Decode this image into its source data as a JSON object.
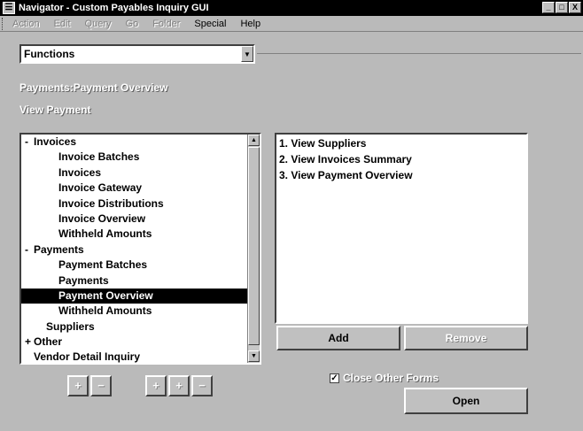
{
  "window": {
    "title": "Navigator - Custom Payables Inquiry GUI",
    "controls": [
      "_",
      "□",
      "X"
    ]
  },
  "menu": [
    {
      "label": "Action",
      "enabled": false
    },
    {
      "label": "Edit",
      "enabled": false
    },
    {
      "label": "Query",
      "enabled": false
    },
    {
      "label": "Go",
      "enabled": false
    },
    {
      "label": "Folder",
      "enabled": false
    },
    {
      "label": "Special",
      "enabled": true
    },
    {
      "label": "Help",
      "enabled": true
    }
  ],
  "functions_dropdown": {
    "value": "Functions"
  },
  "header": {
    "path": "Payments:Payment Overview",
    "subtitle": "View Payment"
  },
  "tree": {
    "items": [
      {
        "marker": "-",
        "indent": 0,
        "label": "Invoices"
      },
      {
        "marker": "",
        "indent": 1,
        "label": "Invoice Batches"
      },
      {
        "marker": "",
        "indent": 1,
        "label": "Invoices"
      },
      {
        "marker": "",
        "indent": 1,
        "label": "Invoice Gateway"
      },
      {
        "marker": "",
        "indent": 1,
        "label": "Invoice Distributions"
      },
      {
        "marker": "",
        "indent": 1,
        "label": "Invoice Overview"
      },
      {
        "marker": "",
        "indent": 1,
        "label": "Withheld Amounts"
      },
      {
        "marker": "-",
        "indent": 0,
        "label": "Payments"
      },
      {
        "marker": "",
        "indent": 1,
        "label": "Payment Batches"
      },
      {
        "marker": "",
        "indent": 1,
        "label": "Payments"
      },
      {
        "marker": "",
        "indent": 1,
        "label": "Payment Overview",
        "selected": true
      },
      {
        "marker": "",
        "indent": 1,
        "label": "Withheld Amounts"
      },
      {
        "marker": "",
        "indent": 0.5,
        "label": "Suppliers"
      },
      {
        "marker": "+",
        "indent": 0,
        "label": "Other"
      },
      {
        "marker": "",
        "indent": 0,
        "label": "Vendor Detail Inquiry"
      }
    ]
  },
  "doclist": {
    "items": [
      "1. View Suppliers",
      "2. View Invoices Summary",
      "3. View Payment Overview"
    ]
  },
  "buttons": {
    "add": "Add",
    "remove": "Remove",
    "open": "Open",
    "tree_controls": [
      "+",
      "−",
      "+",
      "+",
      "−"
    ]
  },
  "close_other_forms": {
    "label": "Close Other Forms",
    "checked": true,
    "mark": "✓"
  }
}
